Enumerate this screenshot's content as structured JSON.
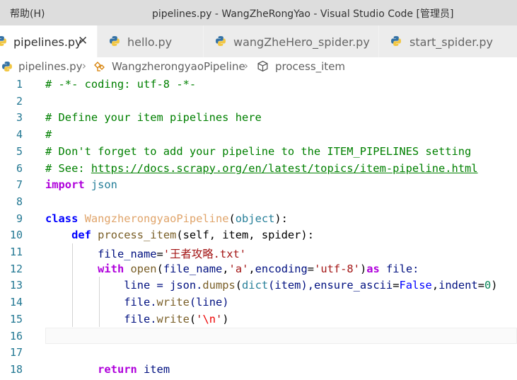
{
  "titlebar": {
    "menu_help": "帮助(H)",
    "title": "pipelines.py - WangZheRongYao - Visual Studio Code [管理员]"
  },
  "tabs": [
    {
      "label": "pipelines.py",
      "icon": "python-file-icon",
      "active": true
    },
    {
      "label": "hello.py",
      "icon": "python-file-icon",
      "active": false
    },
    {
      "label": "wangZheHero_spider.py",
      "icon": "python-file-icon",
      "active": false
    },
    {
      "label": "start_spider.py",
      "icon": "python-file-icon",
      "active": false
    }
  ],
  "close_glyph": "✕",
  "breadcrumb": {
    "file": "pipelines.py",
    "class": "WangzherongyaoPipeline",
    "method": "process_item",
    "separator": "›"
  },
  "code": {
    "line_numbers": [
      "1",
      "2",
      "3",
      "4",
      "5",
      "6",
      "7",
      "8",
      "9",
      "10",
      "11",
      "12",
      "13",
      "14",
      "15",
      "16",
      "17",
      "18"
    ],
    "l1": "# -*- coding: utf-8 -*-",
    "l3": "# Define your item pipelines here",
    "l4": "#",
    "l5": "# Don't forget to add your pipeline to the ITEM_PIPELINES setting",
    "l6_prefix": "# See: ",
    "l6_link": "https://docs.scrapy.org/en/latest/topics/item-pipeline.html",
    "l7_kw": "import",
    "l7_mod": " json",
    "l9_kw": "class",
    "l9_cls": "WangzherongyaoPipeline",
    "l9_open": "(",
    "l9_base": "object",
    "l9_close": "):",
    "l10_kw": "def",
    "l10_fn": "process_item",
    "l10_params": "(self, item, spider):",
    "l11_var": "file_name",
    "l11_eq": "=",
    "l11_str": "'王者攻略.txt'",
    "l12_kw": "with",
    "l12_fn": "open",
    "l12_a": "(",
    "l12_var1": "file_name",
    "l12_b": ",",
    "l12_str1": "'a'",
    "l12_c": ",",
    "l12_param": "encoding",
    "l12_d": "=",
    "l12_str2": "'utf-8'",
    "l12_e": ")",
    "l12_as": "as",
    "l12_file": " file:",
    "l13_a": "line = json.",
    "l13_fn1": "dumps",
    "l13_b": "(",
    "l13_fn2": "dict",
    "l13_c": "(item),",
    "l13_param1": "ensure_ascii",
    "l13_d": "=",
    "l13_false": "False",
    "l13_e": ",",
    "l13_param2": "indent",
    "l13_f": "=",
    "l13_zero": "0",
    "l13_g": ")",
    "l14_a": "file.",
    "l14_fn": "write",
    "l14_b": "(line)",
    "l15_a": "file.",
    "l15_fn": "write",
    "l15_b": "(",
    "l15_q1": "'",
    "l15_esc": "\\n",
    "l15_q2": "'",
    "l15_c": ")",
    "l18_kw": "return",
    "l18_var": " item"
  }
}
